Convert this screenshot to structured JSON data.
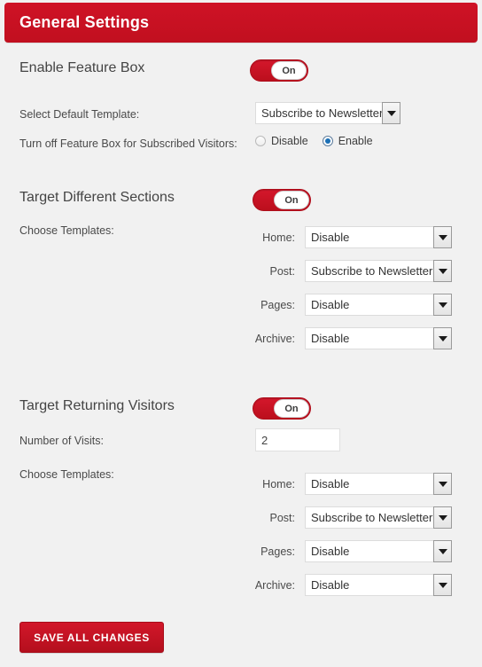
{
  "header": {
    "title": "General Settings"
  },
  "sections": [
    {
      "title": "Enable Feature Box",
      "toggle_label": "On",
      "rows": {
        "default_template_label": "Select Default Template:",
        "default_template_value": "Subscribe to Newsletter",
        "turn_off_label": "Turn off Feature Box for Subscribed Visitors:",
        "radios": [
          {
            "label": "Disable",
            "checked": false
          },
          {
            "label": "Enable",
            "checked": true
          }
        ]
      }
    },
    {
      "title": "Target Different Sections",
      "toggle_label": "On",
      "choose_templates_label": "Choose Templates:",
      "templates": [
        {
          "label": "Home:",
          "value": "Disable"
        },
        {
          "label": "Post:",
          "value": "Subscribe to Newsletter"
        },
        {
          "label": "Pages:",
          "value": "Disable"
        },
        {
          "label": "Archive:",
          "value": "Disable"
        }
      ]
    },
    {
      "title": "Target Returning Visitors",
      "toggle_label": "On",
      "visits_label": "Number of Visits:",
      "visits_value": "2",
      "choose_templates_label": "Choose Templates:",
      "templates": [
        {
          "label": "Home:",
          "value": "Disable"
        },
        {
          "label": "Post:",
          "value": "Subscribe to Newsletter"
        },
        {
          "label": "Pages:",
          "value": "Disable"
        },
        {
          "label": "Archive:",
          "value": "Disable"
        }
      ]
    }
  ],
  "footer": {
    "save_label": "SAVE ALL CHANGES"
  }
}
